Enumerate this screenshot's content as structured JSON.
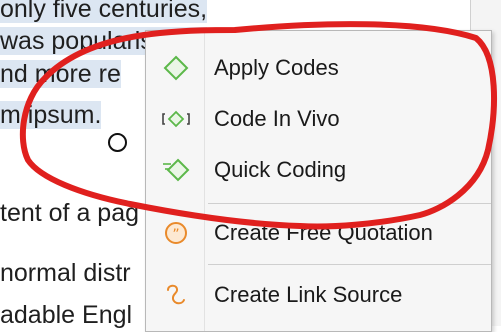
{
  "document": {
    "lines": [
      {
        "before": "",
        "selected": "only five centuries,",
        "after": ""
      },
      {
        "before": "",
        "selected": "was popularised in",
        "after": ""
      },
      {
        "before": "",
        "selected": "nd more re",
        "after": ""
      },
      {
        "before": "",
        "selected": "m ipsum.",
        "after": ""
      },
      {
        "before": "tent of a pag",
        "selected": "",
        "after": ""
      },
      {
        "before": "normal distr",
        "selected": "",
        "after": ""
      },
      {
        "before": "adable Engl",
        "selected": "",
        "after": ""
      }
    ]
  },
  "context_menu": {
    "items": [
      {
        "label": "Apply Codes",
        "icon": "diamond-icon"
      },
      {
        "label": "Code In Vivo",
        "icon": "code-in-vivo-icon"
      },
      {
        "label": "Quick Coding",
        "icon": "quick-coding-icon"
      },
      {
        "label": "Create Free Quotation",
        "icon": "quotation-icon"
      },
      {
        "label": "Create Link Source",
        "icon": "link-source-icon"
      }
    ]
  },
  "colors": {
    "annotation": "#e0201e",
    "code_icon": "#5cb84a",
    "quotation_icon": "#e98a2b",
    "selection": "#dce6f2"
  }
}
